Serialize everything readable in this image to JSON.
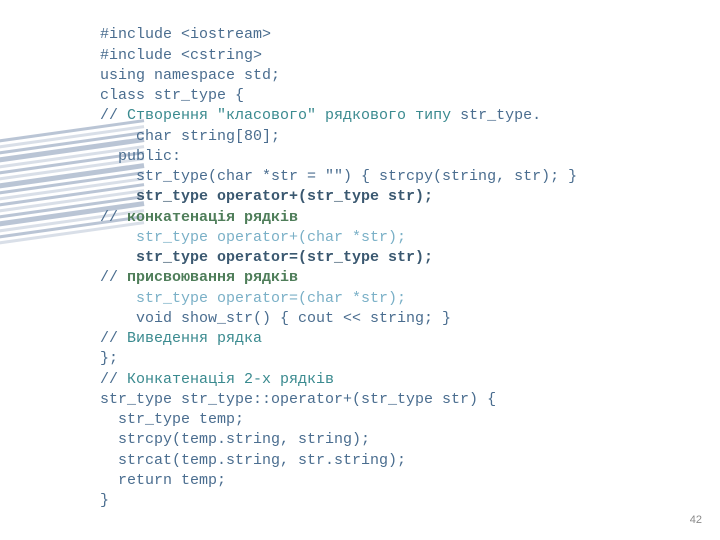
{
  "code": {
    "l01": "#include <iostream>",
    "l02": "#include <cstring>",
    "l03": "using namespace std;",
    "l04": "class str_type {",
    "l05a": "// ",
    "l05b": "Створення \"класового\" рядкового типу",
    "l05c": " str_type.",
    "l06": "    char string[80];",
    "l07": "  public:",
    "l08": "    str_type(char *str = \"\") { strcpy(string, str); }",
    "l09": "    str_type operator+(str_type str);",
    "l10a": "// ",
    "l10b": "конкатенація рядків",
    "l11": "    str_type operator+(char *str);",
    "l12": "    str_type operator=(str_type str);",
    "l13a": "// ",
    "l13b": "присвоювання рядків",
    "l14": "    str_type operator=(char *str);",
    "l15": "    void show_str() { cout << string; }",
    "l16a": "// ",
    "l16b": "Виведення рядка",
    "l17": "};",
    "l18a": "// ",
    "l18b": "Конкатенація 2-х рядків",
    "l19": "str_type str_type::operator+(str_type str) {",
    "l20": "  str_type temp;",
    "l21": "  strcpy(temp.string, string);",
    "l22": "  strcat(temp.string, str.string);",
    "l23": "  return temp;",
    "l24": "}"
  },
  "page_number": "42"
}
